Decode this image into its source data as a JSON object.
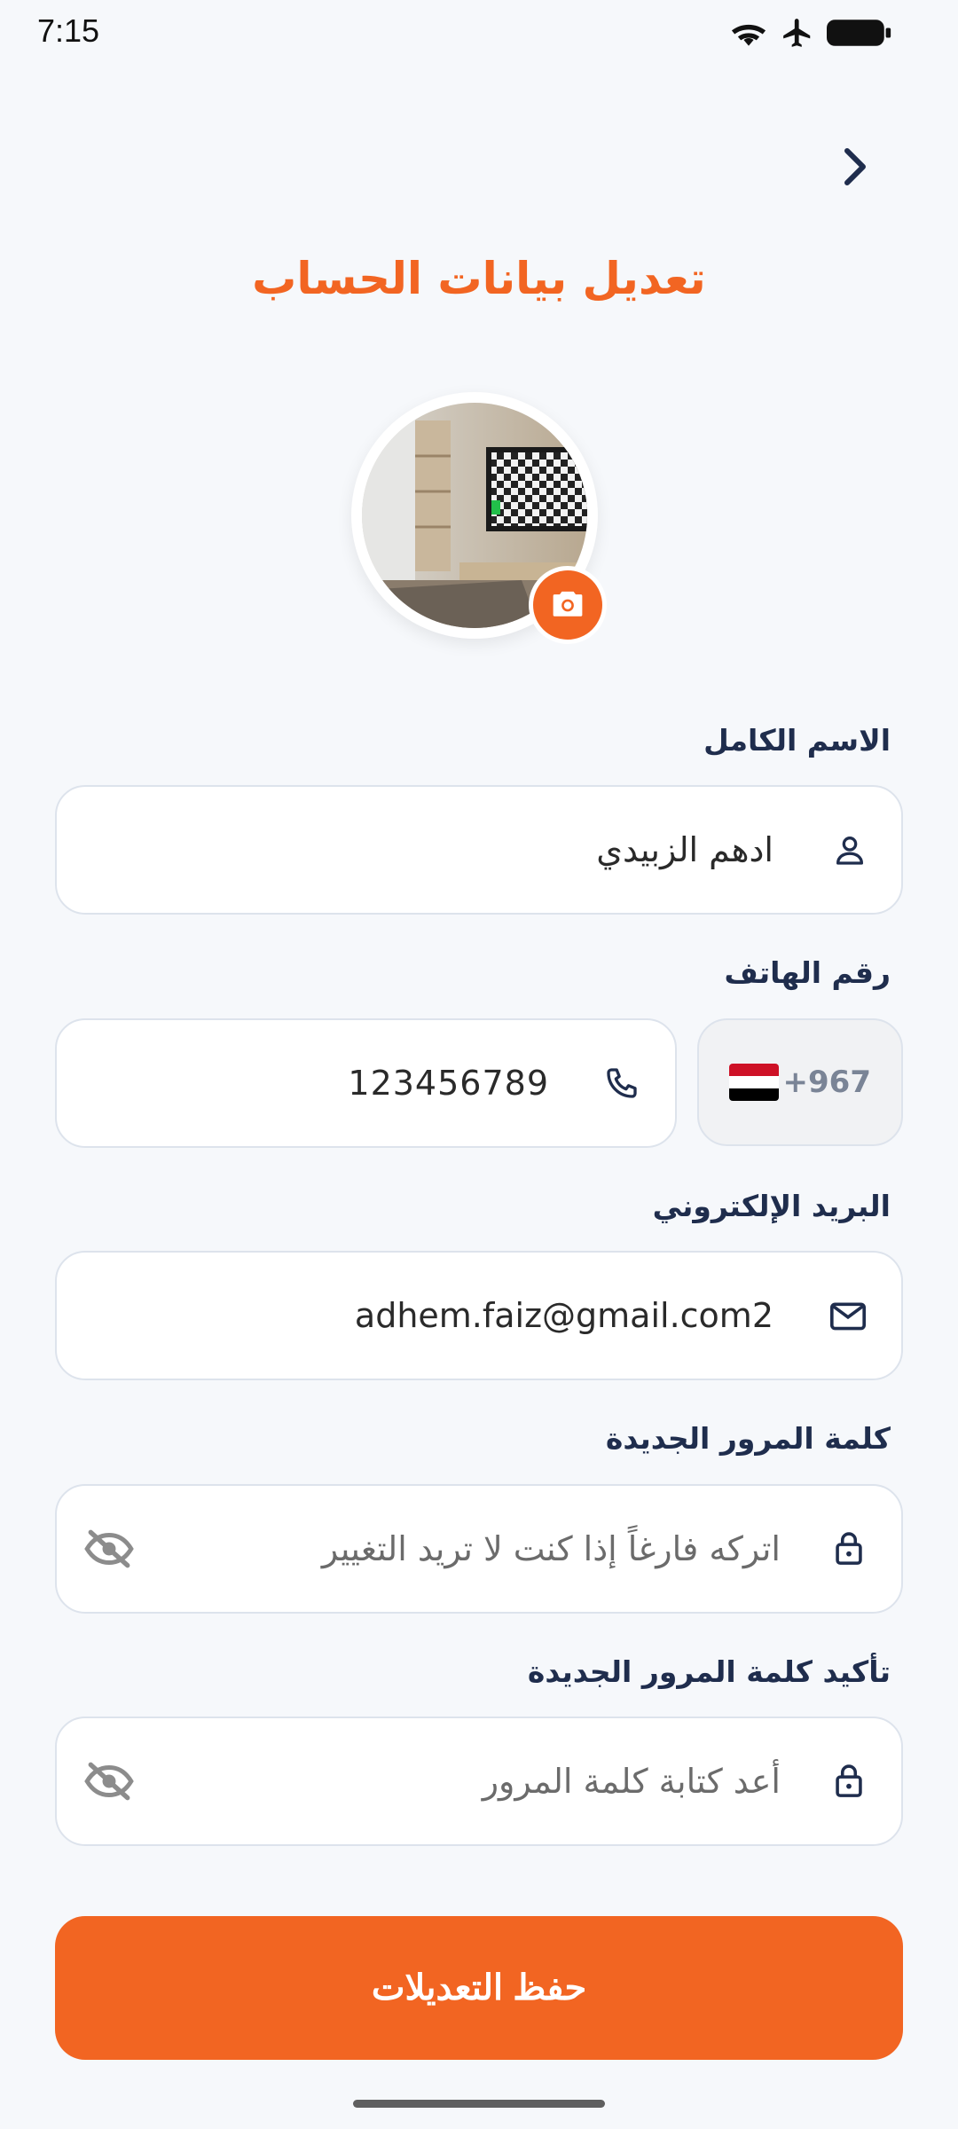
{
  "status": {
    "time": "7:15"
  },
  "page": {
    "title": "تعديل بيانات الحساب"
  },
  "form": {
    "full_name": {
      "label": "الاسم الكامل",
      "value": "ادهم الزبيدي"
    },
    "phone": {
      "label": "رقم الهاتف",
      "country_code": "+967",
      "value": "123456789"
    },
    "email": {
      "label": "البريد الإلكتروني",
      "value": "adhem.faiz@gmail.com2"
    },
    "new_password": {
      "label": "كلمة المرور الجديدة",
      "placeholder": "اتركه فارغاً إذا كنت لا تريد التغيير"
    },
    "confirm_password": {
      "label": "تأكيد كلمة المرور الجديدة",
      "placeholder": "أعد كتابة كلمة المرور"
    }
  },
  "actions": {
    "save_label": "حفظ التعديلات"
  },
  "colors": {
    "accent": "#f26522",
    "primary_text": "#1f2d4d",
    "background": "#f6f8fb"
  },
  "icons": [
    "back-chevron-icon",
    "camera-icon",
    "user-icon",
    "phone-icon",
    "mail-icon",
    "lock-icon",
    "eye-off-icon",
    "yemen-flag-icon",
    "wifi-icon",
    "airplane-icon",
    "battery-icon"
  ]
}
